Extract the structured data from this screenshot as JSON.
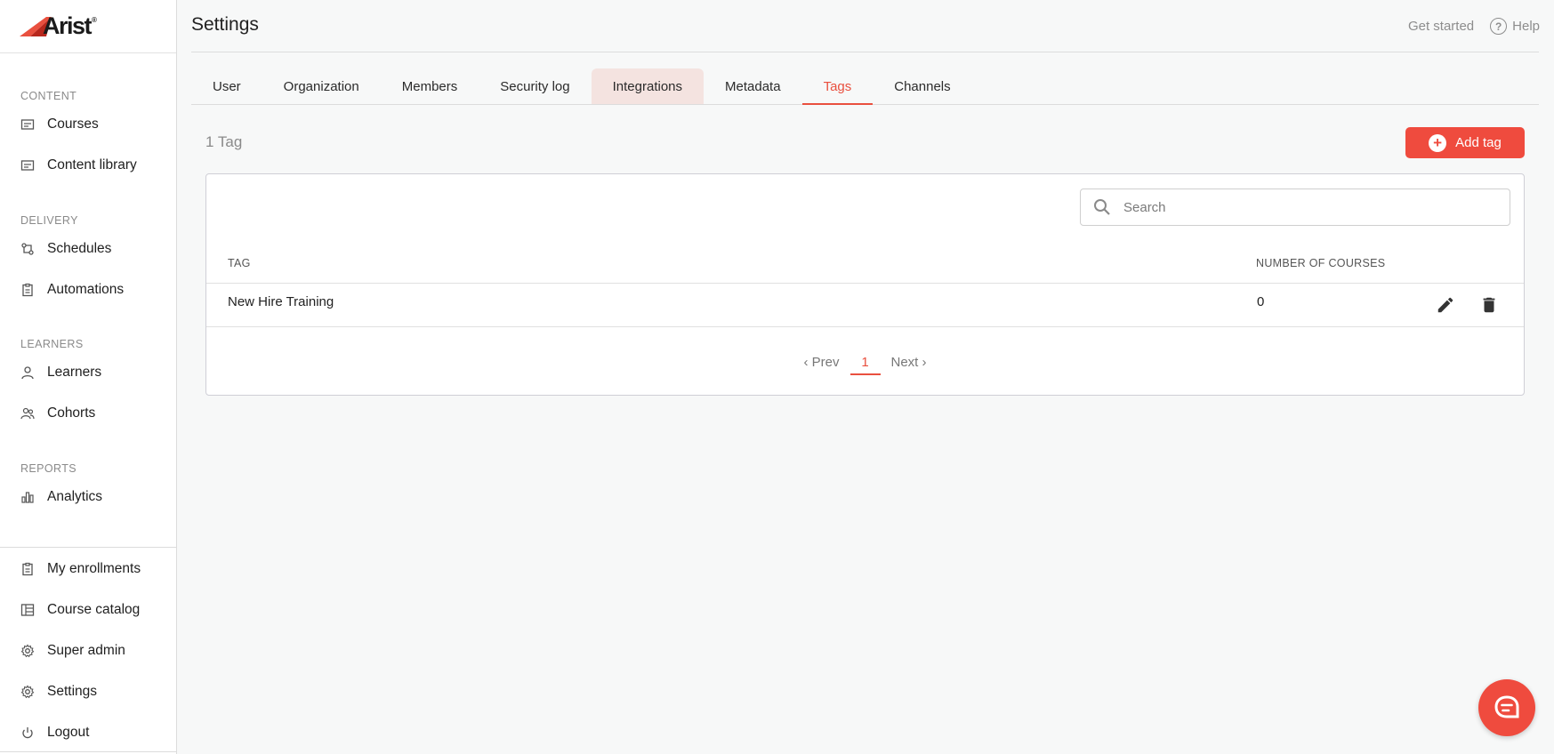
{
  "brand": {
    "name": "Arist",
    "mark": "®",
    "accent": "#ef4b3e"
  },
  "sidebar": {
    "sections": [
      {
        "heading": "CONTENT",
        "items": [
          {
            "label": "Courses",
            "icon": "courses-icon"
          },
          {
            "label": "Content library",
            "icon": "library-icon"
          }
        ]
      },
      {
        "heading": "DELIVERY",
        "items": [
          {
            "label": "Schedules",
            "icon": "schedules-icon"
          },
          {
            "label": "Automations",
            "icon": "automations-icon"
          }
        ]
      },
      {
        "heading": "LEARNERS",
        "items": [
          {
            "label": "Learners",
            "icon": "user-icon"
          },
          {
            "label": "Cohorts",
            "icon": "users-icon"
          }
        ]
      },
      {
        "heading": "REPORTS",
        "items": [
          {
            "label": "Analytics",
            "icon": "bar-chart-icon"
          }
        ]
      }
    ],
    "bottom_items": [
      {
        "label": "My enrollments",
        "icon": "clipboard-icon"
      },
      {
        "label": "Course catalog",
        "icon": "catalog-icon"
      },
      {
        "label": "Super admin",
        "icon": "gear-icon"
      },
      {
        "label": "Settings",
        "icon": "gear-icon"
      },
      {
        "label": "Logout",
        "icon": "power-icon"
      }
    ]
  },
  "header": {
    "title": "Settings",
    "get_started": "Get started",
    "help": "Help",
    "help_glyph": "?"
  },
  "tabs": [
    {
      "label": "User",
      "state": "normal"
    },
    {
      "label": "Organization",
      "state": "normal"
    },
    {
      "label": "Members",
      "state": "normal"
    },
    {
      "label": "Security log",
      "state": "normal"
    },
    {
      "label": "Integrations",
      "state": "hover"
    },
    {
      "label": "Metadata",
      "state": "normal"
    },
    {
      "label": "Tags",
      "state": "active"
    },
    {
      "label": "Channels",
      "state": "normal"
    }
  ],
  "tags_page": {
    "count_label": "1 Tag",
    "add_button": "Add tag",
    "add_glyph": "+",
    "search_placeholder": "Search",
    "columns": {
      "tag": "TAG",
      "courses": "NUMBER OF COURSES"
    },
    "rows": [
      {
        "tag": "New Hire Training",
        "courses": "0"
      }
    ],
    "pager": {
      "prev": "‹ Prev",
      "current": "1",
      "next": "Next ›"
    }
  }
}
